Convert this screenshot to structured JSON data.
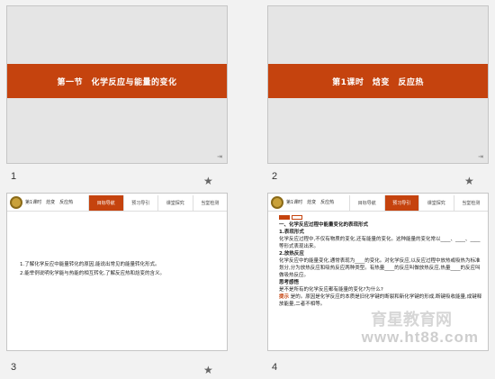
{
  "slides": [
    {
      "number": "1",
      "band_title": "第一节　化学反应与能量的变化",
      "forward_icon": "⇥"
    },
    {
      "number": "2",
      "band_title": "第1课时　焓变　反应热",
      "forward_icon": "⇥"
    },
    {
      "number": "3",
      "header_title": "第1课时　焓变　反应热",
      "tabs": [
        "目标导航",
        "预习导引",
        "课堂探究",
        "当堂检测"
      ],
      "active_tab": 0,
      "lines": [
        "1.了解化学反应中能量转化的原因,能说出常见的能量转化形式。",
        "2.能举例说明化学能与热能的相互转化,了解反应热和焓变的含义。"
      ]
    },
    {
      "number": "4",
      "header_title": "第1课时　焓变　反应热",
      "tabs": [
        "目标导航",
        "预习导引",
        "课堂探究",
        "当堂检测"
      ],
      "active_tab": 1,
      "section1": "一、化学反应过程中能量变化的表现形式",
      "sub1": "1.表现形式",
      "text1": "化学反应过程中,不仅有物质的变化,还有能量的变化。这种能量的变化常以____、____、____等形式表现出来。",
      "sub2": "2.放热反应",
      "text2": "化学反应中的能量变化,通常表现为____的变化。对化学反应,以反应过程中放热或吸热为标准划分,分为放热反应和吸热反应两种类型。有热量____的反应叫做放热反应,热量____的反应叫做吸热反应。",
      "think_title": "思考感悟",
      "question": "是不是所有的化学反应都有能量的变化?为什么?",
      "hint_label": "提示",
      "hint_text": "是的。原因是化学反应的本质是旧化学键的断裂和新化学键的形成,断键吸收能量,成键释放能量,二者不相等。",
      "watermark": "www.ht88.com",
      "watermark_top": "育星教育网"
    }
  ],
  "star_icon": "★",
  "colors": {
    "accent": "#c5430e",
    "slide_bg": "#e5e5e5"
  }
}
